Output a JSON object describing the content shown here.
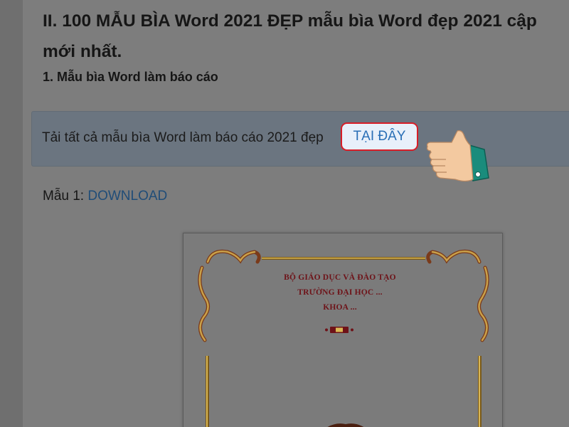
{
  "article": {
    "heading_line1": "II. 100 MẪU BÌA Word 2021 ĐẸP mẫu bìa Word đẹp 2021 cập",
    "heading_line2": "mới nhất.",
    "subheading": "1. Mẫu bìa Word làm báo cáo"
  },
  "notice": {
    "text": "Tải tất cả mẫu bìa Word làm báo cáo 2021 đẹp",
    "link_label": "TẠI ĐÂY"
  },
  "download": {
    "prefix": "Mẫu 1: ",
    "link_label": "DOWNLOAD"
  },
  "preview": {
    "line1": "BỘ GIÁO DỤC VÀ ĐÀO TẠO",
    "line2": "TRƯỜNG ĐẠI HỌC ...",
    "line3": "KHOA ..."
  },
  "icons": {
    "pointer": "pointing-hand-icon",
    "book": "book-icon",
    "corner_ornament": "ornament-icon"
  },
  "colors": {
    "link": "#2a6fb6",
    "highlight_border": "#d81d27",
    "cuff": "#1a8c7c",
    "skin": "#f3c9a0"
  }
}
